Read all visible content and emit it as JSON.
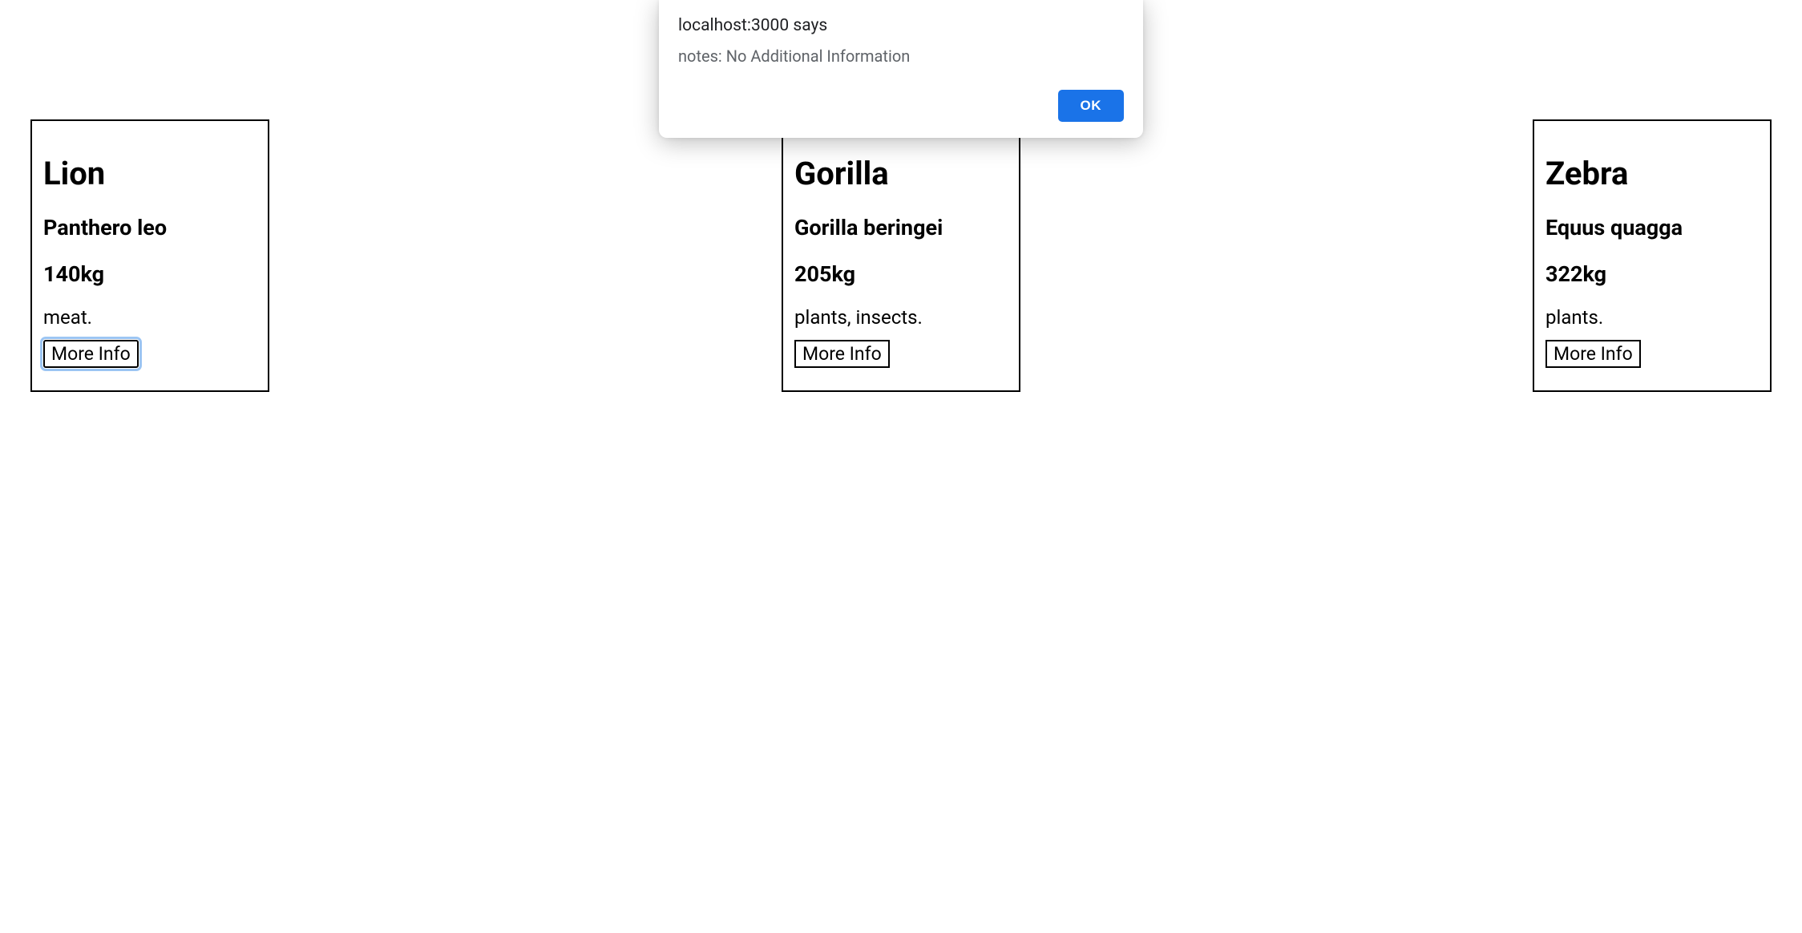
{
  "alert": {
    "title": "localhost:3000 says",
    "message": "notes: No Additional Information",
    "ok_label": "OK"
  },
  "cards": [
    {
      "name": "Lion",
      "species": "Panthero leo",
      "weight": "140kg",
      "diet": "meat.",
      "button_label": "More Info",
      "focused": true
    },
    {
      "name": "Gorilla",
      "species": "Gorilla beringei",
      "weight": "205kg",
      "diet": "plants, insects.",
      "button_label": "More Info",
      "focused": false
    },
    {
      "name": "Zebra",
      "species": "Equus quagga",
      "weight": "322kg",
      "diet": "plants.",
      "button_label": "More Info",
      "focused": false
    }
  ]
}
